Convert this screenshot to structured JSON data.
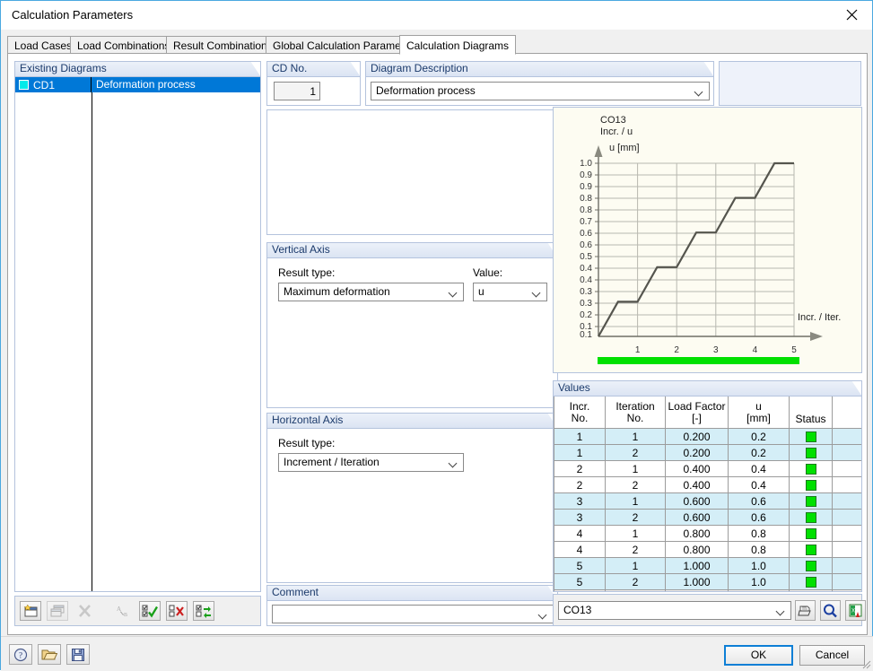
{
  "window": {
    "title": "Calculation Parameters",
    "close_icon": "close-icon"
  },
  "tabs": [
    {
      "label": "Load Cases",
      "active": false
    },
    {
      "label": "Load Combinations",
      "active": false
    },
    {
      "label": "Result Combinations",
      "active": false
    },
    {
      "label": "Global Calculation Parameters",
      "active": false
    },
    {
      "label": "Calculation Diagrams",
      "active": true
    }
  ],
  "existing_diagrams": {
    "title": "Existing Diagrams",
    "swatch_color": "#00eaea",
    "rows": [
      {
        "id": "CD1",
        "description": "Deformation process",
        "selected": true
      }
    ]
  },
  "cd_no": {
    "title": "CD No.",
    "value": "1"
  },
  "diagram_description": {
    "title": "Diagram Description",
    "value": "Deformation process",
    "placeholder": ""
  },
  "vertical_axis": {
    "title": "Vertical Axis",
    "result_type_label": "Result type:",
    "result_type_value": "Maximum deformation",
    "value_label": "Value:",
    "value_value": "u"
  },
  "horizontal_axis": {
    "title": "Horizontal Axis",
    "result_type_label": "Result type:",
    "result_type_value": "Increment / Iteration"
  },
  "comment": {
    "title": "Comment",
    "value": "",
    "placeholder": ""
  },
  "left_toolbar": [
    {
      "name": "new-diagram-button",
      "icon": "new-window-icon",
      "enabled": true
    },
    {
      "name": "copy-diagram-button",
      "icon": "copy-window-icon",
      "enabled": false
    },
    {
      "name": "delete-diagram-button",
      "icon": "delete-x-icon",
      "enabled": false
    },
    {
      "name": "rename-button",
      "icon": "text-cursor-icon",
      "enabled": false
    },
    {
      "name": "select-all-button",
      "icon": "checkboxes-check-icon",
      "enabled": true
    },
    {
      "name": "deselect-all-button",
      "icon": "checkboxes-x-icon",
      "enabled": true
    },
    {
      "name": "invert-selection-button",
      "icon": "checkboxes-swap-icon",
      "enabled": true
    }
  ],
  "values": {
    "title": "Values",
    "columns": [
      {
        "line1": "Incr.",
        "line2": "No."
      },
      {
        "line1": "Iteration",
        "line2": "No."
      },
      {
        "line1": "Load Factor",
        "line2": "[-]"
      },
      {
        "line1": "u",
        "line2": "[mm]"
      },
      {
        "line1": "",
        "line2": "Status"
      },
      {
        "line1": "",
        "line2": ""
      }
    ],
    "rows": [
      {
        "incr": "1",
        "iter": "1",
        "load_factor": "0.200",
        "u": "0.2",
        "status": "ok",
        "alt": true
      },
      {
        "incr": "1",
        "iter": "2",
        "load_factor": "0.200",
        "u": "0.2",
        "status": "ok",
        "alt": true
      },
      {
        "incr": "2",
        "iter": "1",
        "load_factor": "0.400",
        "u": "0.4",
        "status": "ok",
        "alt": false
      },
      {
        "incr": "2",
        "iter": "2",
        "load_factor": "0.400",
        "u": "0.4",
        "status": "ok",
        "alt": false
      },
      {
        "incr": "3",
        "iter": "1",
        "load_factor": "0.600",
        "u": "0.6",
        "status": "ok",
        "alt": true
      },
      {
        "incr": "3",
        "iter": "2",
        "load_factor": "0.600",
        "u": "0.6",
        "status": "ok",
        "alt": true
      },
      {
        "incr": "4",
        "iter": "1",
        "load_factor": "0.800",
        "u": "0.8",
        "status": "ok",
        "alt": false
      },
      {
        "incr": "4",
        "iter": "2",
        "load_factor": "0.800",
        "u": "0.8",
        "status": "ok",
        "alt": false
      },
      {
        "incr": "5",
        "iter": "1",
        "load_factor": "1.000",
        "u": "1.0",
        "status": "ok",
        "alt": true
      },
      {
        "incr": "5",
        "iter": "2",
        "load_factor": "1.000",
        "u": "1.0",
        "status": "ok",
        "alt": true
      }
    ],
    "status_color": "#00e000"
  },
  "result_selector": {
    "value": "CO13",
    "buttons": [
      {
        "name": "print-button",
        "icon": "printer-icon"
      },
      {
        "name": "zoom-button",
        "icon": "magnifier-icon"
      },
      {
        "name": "export-excel-button",
        "icon": "excel-export-icon"
      }
    ]
  },
  "footer": {
    "buttons": [
      {
        "name": "help-button",
        "icon": "help-question-icon"
      },
      {
        "name": "open-button",
        "icon": "folder-open-icon"
      },
      {
        "name": "save-button",
        "icon": "floppy-save-icon"
      }
    ],
    "ok_label": "OK",
    "cancel_label": "Cancel"
  },
  "chart_data": {
    "type": "line",
    "title": "CO13\nIncr. / u",
    "xlabel": "Incr. / Iter.",
    "ylabel": "u [mm]",
    "xlim": [
      0,
      5.4
    ],
    "ylim": [
      0,
      1.08
    ],
    "xticks": [
      1,
      2,
      3,
      4,
      5
    ],
    "yticks": [
      0.1,
      0.1,
      0.2,
      0.3,
      0.3,
      0.4,
      0.4,
      0.5,
      0.6,
      0.6,
      0.7,
      0.8,
      0.8,
      0.9,
      0.9,
      1.0
    ],
    "ytick_values": [
      0.0667,
      0.1333,
      0.2,
      0.2667,
      0.3333,
      0.4,
      0.4667,
      0.5333,
      0.6,
      0.6667,
      0.7333,
      0.8,
      0.8667,
      0.9333,
      1.0
    ],
    "grid": true,
    "legend": false,
    "plot_bgcolor": "#fdfcf2",
    "line_color": "#4a4a4a",
    "series": [
      {
        "name": "u",
        "x": [
          0.0,
          0.5,
          1.0,
          1.5,
          2.0,
          2.5,
          3.0,
          3.5,
          4.0,
          4.5,
          5.0
        ],
        "y": [
          0.0,
          0.2,
          0.2,
          0.4,
          0.4,
          0.6,
          0.6,
          0.8,
          0.8,
          1.0,
          1.0
        ]
      }
    ],
    "progress_bar": {
      "color": "#00e000",
      "percent": 100
    }
  }
}
